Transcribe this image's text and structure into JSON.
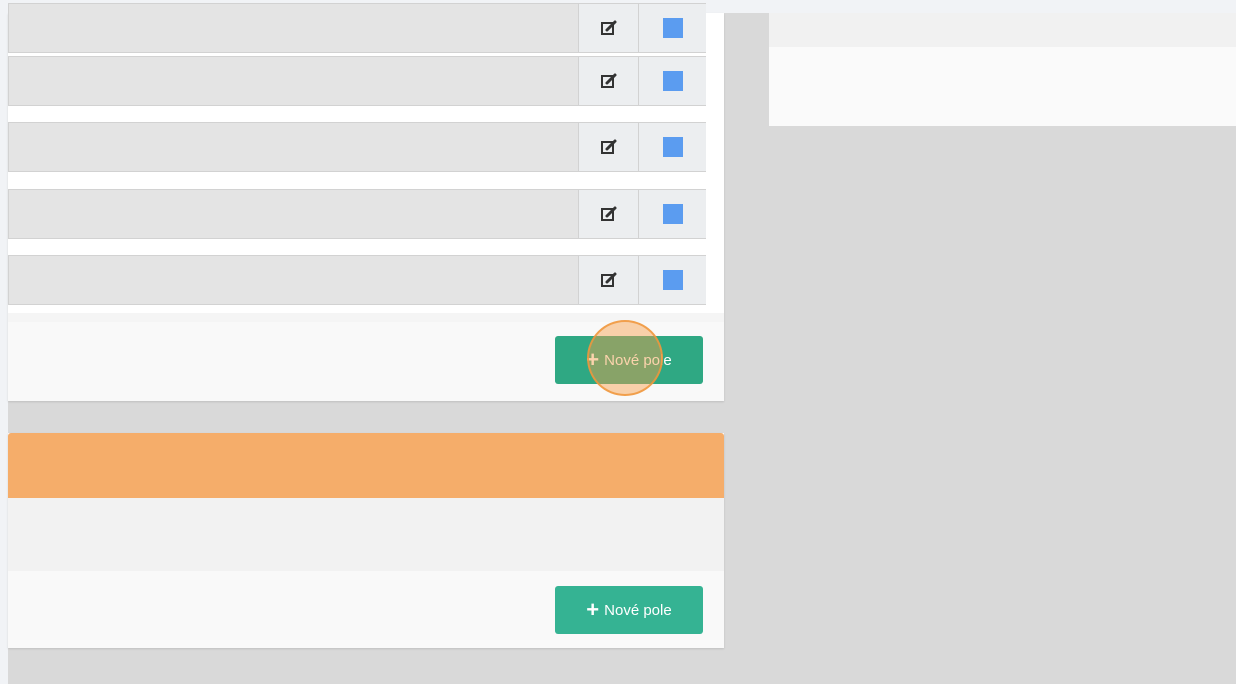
{
  "icons": {
    "edit": "edit-icon",
    "add": "plus-icon"
  },
  "colors": {
    "field_color_swatch": "#5b9cf0",
    "add_button": "#35b393",
    "panel2_header": "#f5ad6a",
    "click_highlight": "#f79e48"
  },
  "panel1": {
    "add_button": {
      "plus": "+",
      "label": "Nové pole"
    }
  },
  "panel2": {
    "add_button": {
      "plus": "+",
      "label": "Nové pole"
    }
  }
}
